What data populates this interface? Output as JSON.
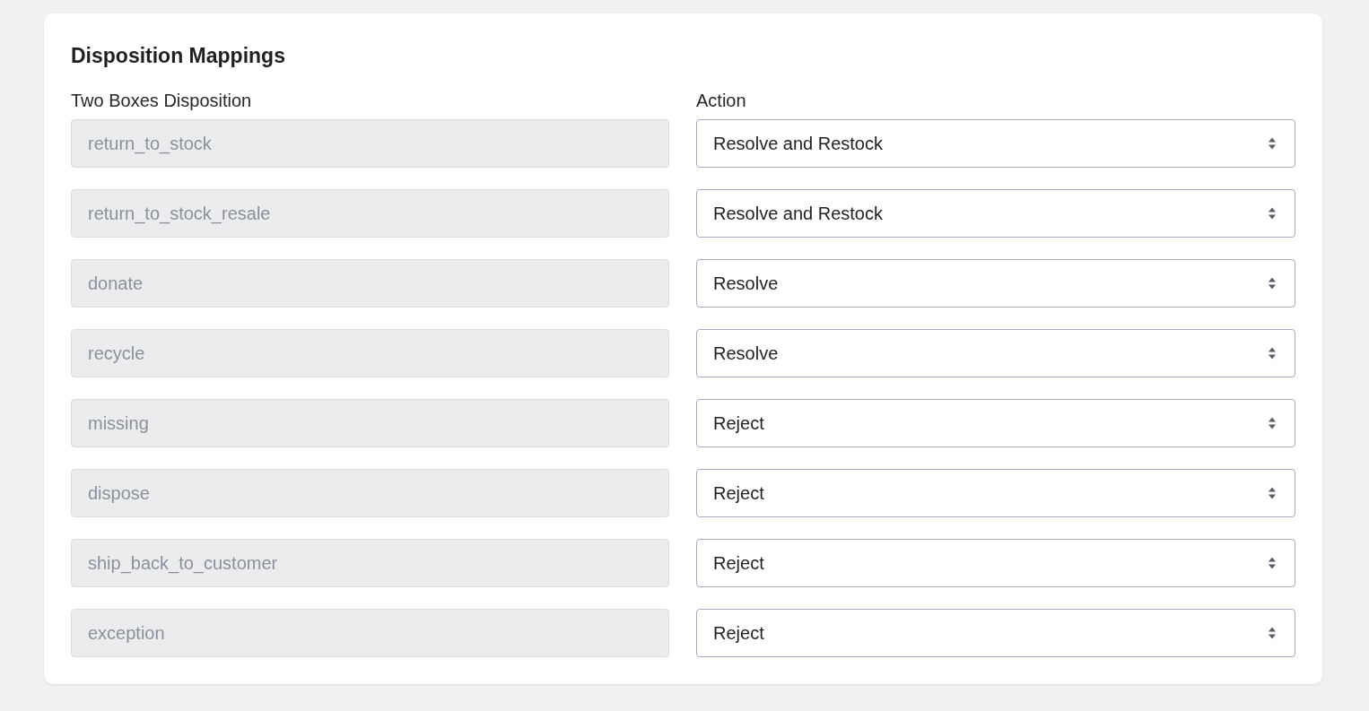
{
  "card": {
    "title": "Disposition Mappings",
    "columns": [
      "Two Boxes Disposition",
      "Action"
    ],
    "rows": [
      {
        "disposition": "return_to_stock",
        "disabled": true,
        "action": "Resolve and Restock"
      },
      {
        "disposition": "return_to_stock_resale",
        "disabled": true,
        "action": "Resolve and Restock"
      },
      {
        "disposition": "donate",
        "disabled": true,
        "action": "Resolve"
      },
      {
        "disposition": "recycle",
        "disabled": true,
        "action": "Resolve"
      },
      {
        "disposition": "missing",
        "disabled": true,
        "action": "Reject"
      },
      {
        "disposition": "dispose",
        "disabled": true,
        "action": "Reject"
      },
      {
        "disposition": "ship_back_to_customer",
        "disabled": true,
        "action": "Reject"
      },
      {
        "disposition": "exception",
        "disabled": true,
        "action": "Reject"
      }
    ]
  }
}
